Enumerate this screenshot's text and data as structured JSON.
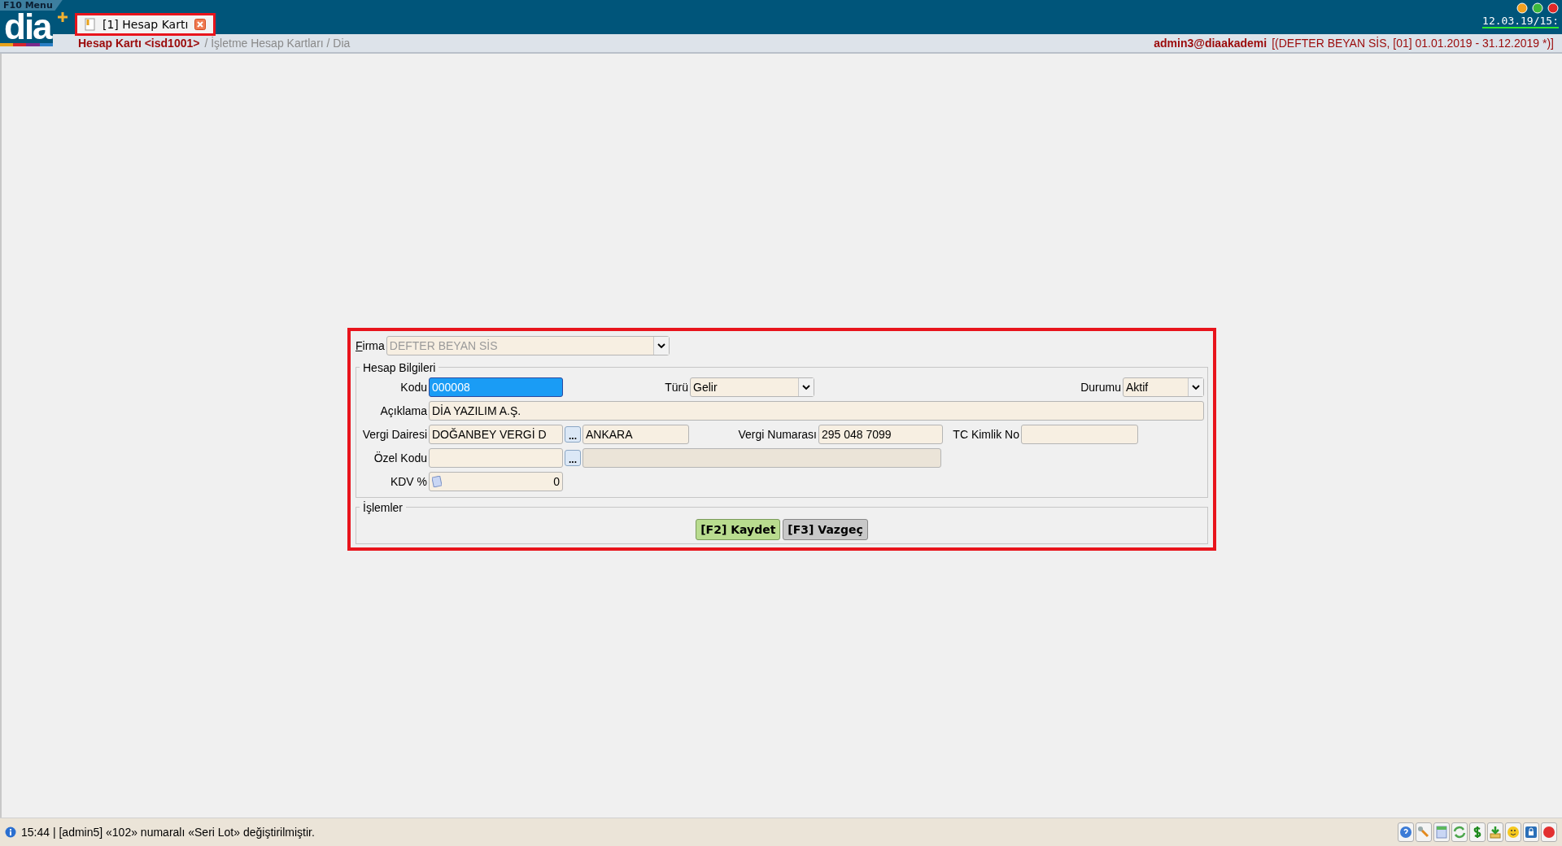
{
  "header": {
    "menu_label": "F10 Menu",
    "logo": "dia",
    "clock": "12.03.19/15:"
  },
  "tabs": [
    {
      "label": "[1] Hesap Kartı",
      "selected": true,
      "highlighted": true
    }
  ],
  "breadcrumb": {
    "title": "Hesap Kartı <isd1001>",
    "path": "/ İşletme Hesap Kartları / Dia"
  },
  "session": {
    "user": "admin3@diaakademi",
    "context": "[(DEFTER BEYAN SİS, [01] 01.01.2019 - 31.12.2019 *)]"
  },
  "form": {
    "highlighted": true,
    "firma": {
      "label": "Firma",
      "value": "DEFTER BEYAN SİS",
      "disabled": true
    },
    "group_title": "Hesap Bilgileri",
    "kodu": {
      "label": "Kodu",
      "value": "000008",
      "focused": true
    },
    "turu": {
      "label": "Türü",
      "value": "Gelir"
    },
    "durumu": {
      "label": "Durumu",
      "value": "Aktif"
    },
    "aciklama": {
      "label": "Açıklama",
      "value": "DİA YAZILIM A.Ş."
    },
    "vergi_dairesi": {
      "label": "Vergi Dairesi",
      "value": "DOĞANBEY VERGİ D",
      "browse_label": "...",
      "city": "ANKARA"
    },
    "vergi_numarasi": {
      "label": "Vergi Numarası",
      "value": "295 048 7099"
    },
    "tc_kimlik_no": {
      "label": "TC Kimlik No"
    },
    "ozel_kodu": {
      "label": "Özel Kodu",
      "browse_label": "...",
      "description_disabled": true
    },
    "kdv": {
      "label": "KDV %",
      "value": "0"
    },
    "actions_title": "İşlemler",
    "buttons": [
      {
        "label": "[F2] Kaydet",
        "kind": "primary"
      },
      {
        "label": "[F3] Vazgeç",
        "kind": "secondary"
      }
    ]
  },
  "status_bar": {
    "message": "15:44 | [admin5] «102» numaralı «Seri Lot» değiştirilmiştir."
  }
}
